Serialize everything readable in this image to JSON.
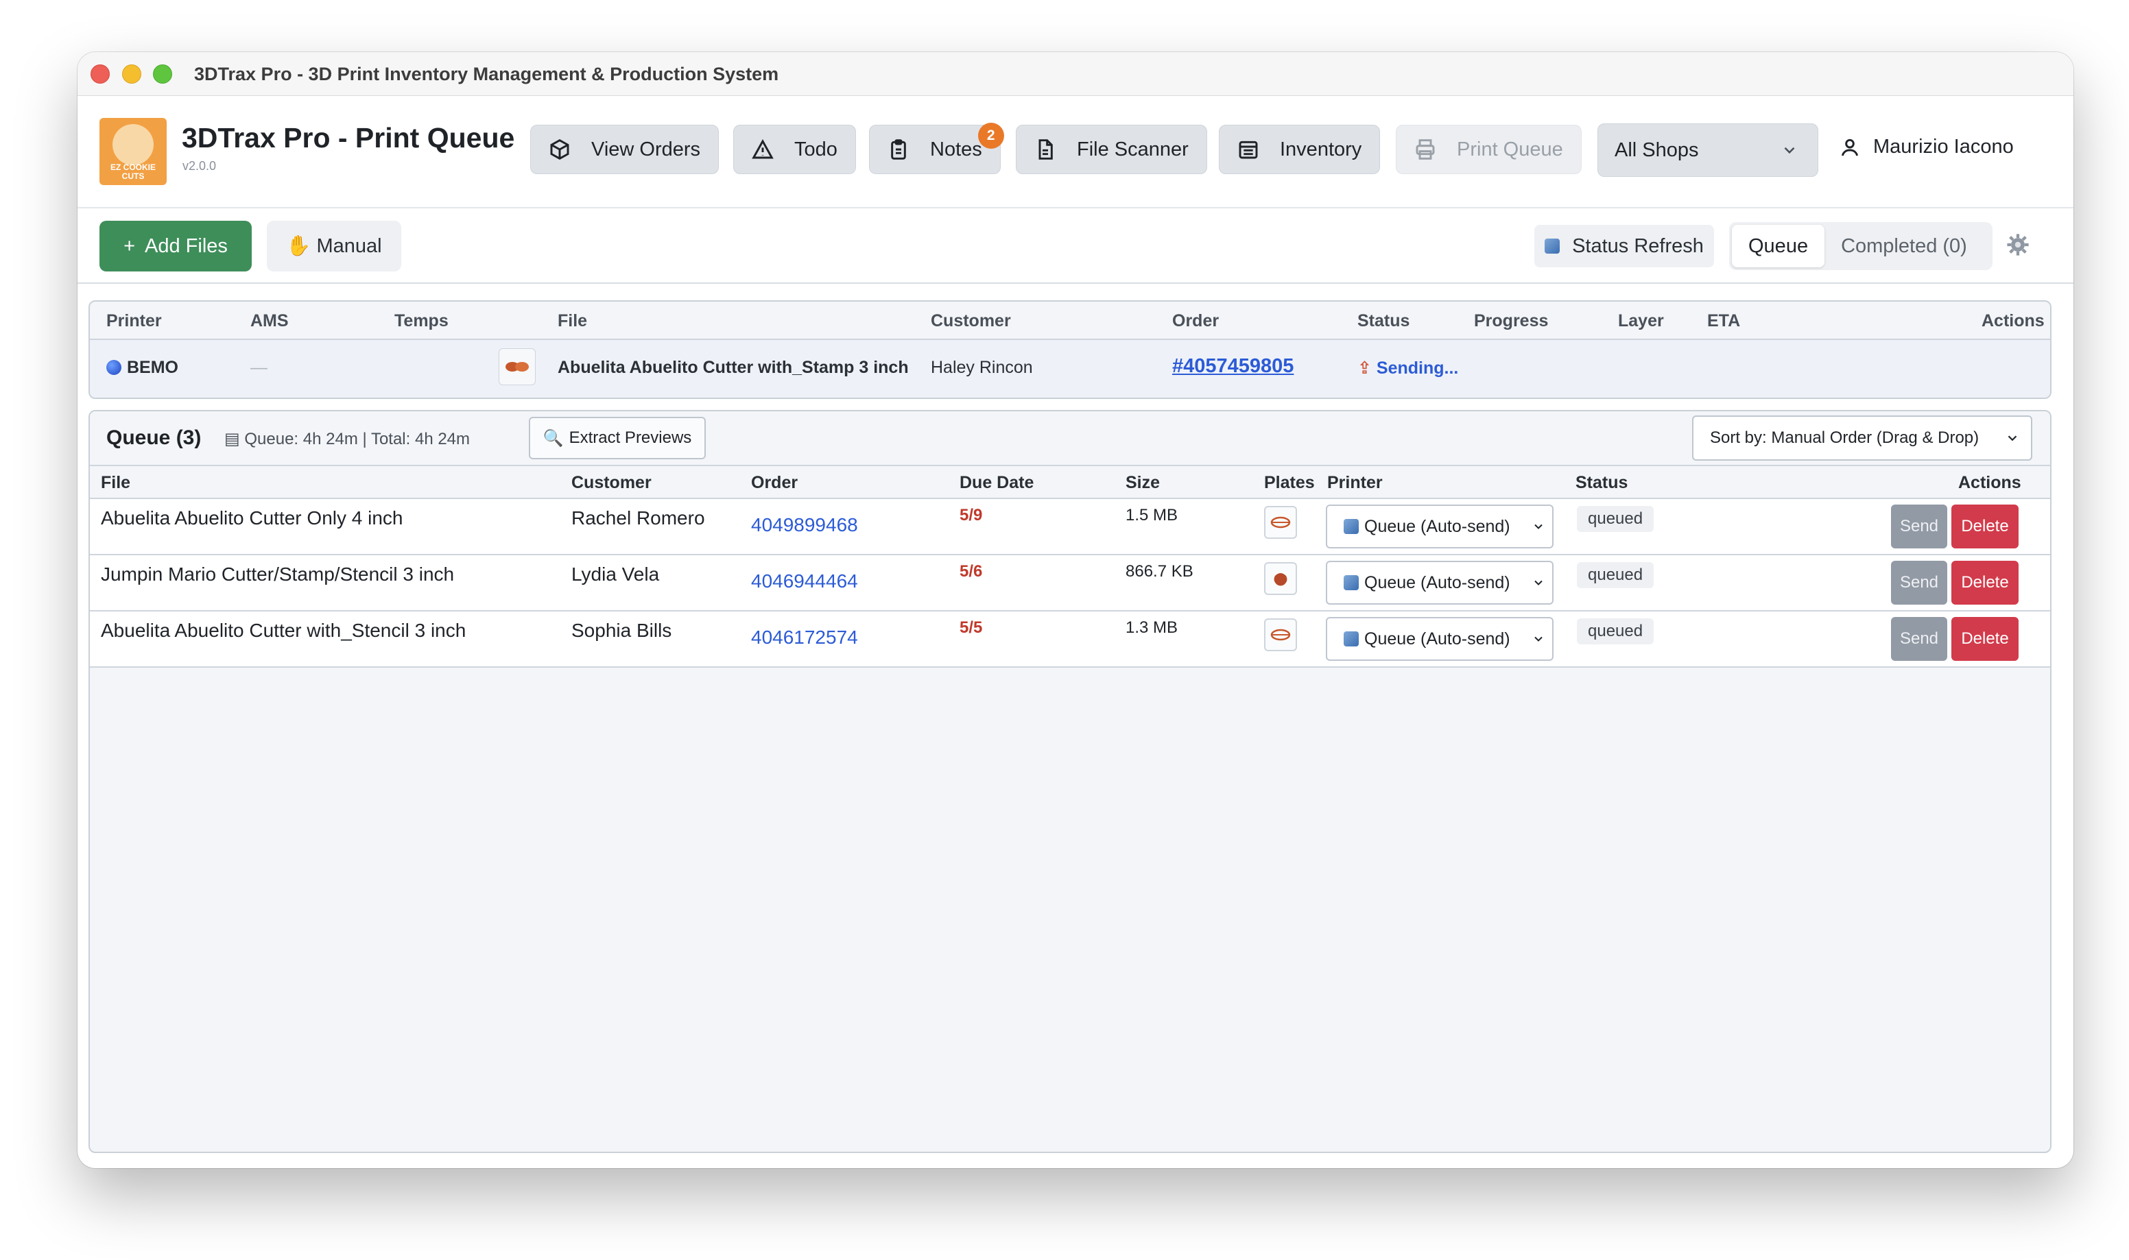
{
  "window": {
    "title": "3DTrax Pro - 3D Print Inventory Management & Production System"
  },
  "header": {
    "app_title": "3DTrax Pro - Print Queue",
    "version": "v2.0.0",
    "logo_text": "EZ COOKIE CUTS",
    "nav": {
      "view_orders": "View Orders",
      "todo": "Todo",
      "notes": "Notes",
      "notes_badge": "2",
      "file_scanner": "File Scanner",
      "inventory": "Inventory",
      "print_queue": "Print Queue"
    },
    "shop_select": "All Shops",
    "user_name": "Maurizio Iacono"
  },
  "toolbar": {
    "add_files": "Add Files",
    "manual": "Manual",
    "status_refresh": "Status Refresh",
    "tab_queue": "Queue",
    "tab_completed": "Completed (0)"
  },
  "active": {
    "columns": {
      "printer": "Printer",
      "ams": "AMS",
      "temps": "Temps",
      "file": "File",
      "customer": "Customer",
      "order": "Order",
      "status": "Status",
      "progress": "Progress",
      "layer": "Layer",
      "eta": "ETA",
      "actions": "Actions"
    },
    "row": {
      "printer": "BEMO",
      "ams": "—",
      "file": "Abuelita Abuelito Cutter with_Stamp 3 inch",
      "customer": "Haley Rincon",
      "order": "#4057459805",
      "status": "Sending..."
    }
  },
  "queue": {
    "title": "Queue (3)",
    "stats": "Queue: 4h 24m | Total: 4h 24m",
    "extract_previews": "Extract Previews",
    "sort_label": "Sort by: Manual Order (Drag & Drop)",
    "columns": {
      "file": "File",
      "customer": "Customer",
      "order": "Order",
      "due_date": "Due Date",
      "size": "Size",
      "plates": "Plates",
      "printer": "Printer",
      "status": "Status",
      "actions": "Actions"
    },
    "rows": [
      {
        "file": "Abuelita Abuelito Cutter Only 4 inch",
        "customer": "Rachel Romero",
        "order": "4049899468",
        "due": "5/9",
        "size": "1.5 MB",
        "printer": "Queue (Auto-send)",
        "status": "queued",
        "send": "Send",
        "delete": "Delete"
      },
      {
        "file": "Jumpin Mario Cutter/Stamp/Stencil 3 inch",
        "customer": "Lydia Vela",
        "order": "4046944464",
        "due": "5/6",
        "size": "866.7 KB",
        "printer": "Queue (Auto-send)",
        "status": "queued",
        "send": "Send",
        "delete": "Delete"
      },
      {
        "file": "Abuelita Abuelito Cutter with_Stencil 3 inch",
        "customer": "Sophia Bills",
        "order": "4046172574",
        "due": "5/5",
        "size": "1.3 MB",
        "printer": "Queue (Auto-send)",
        "status": "queued",
        "send": "Send",
        "delete": "Delete"
      }
    ]
  },
  "colors": {
    "add_button": "#3e8e5a",
    "delete_button": "#d23b4b",
    "send_button": "#929aa5",
    "link": "#2c5bd6",
    "due_date": "#c0392b",
    "badge": "#e97927"
  }
}
